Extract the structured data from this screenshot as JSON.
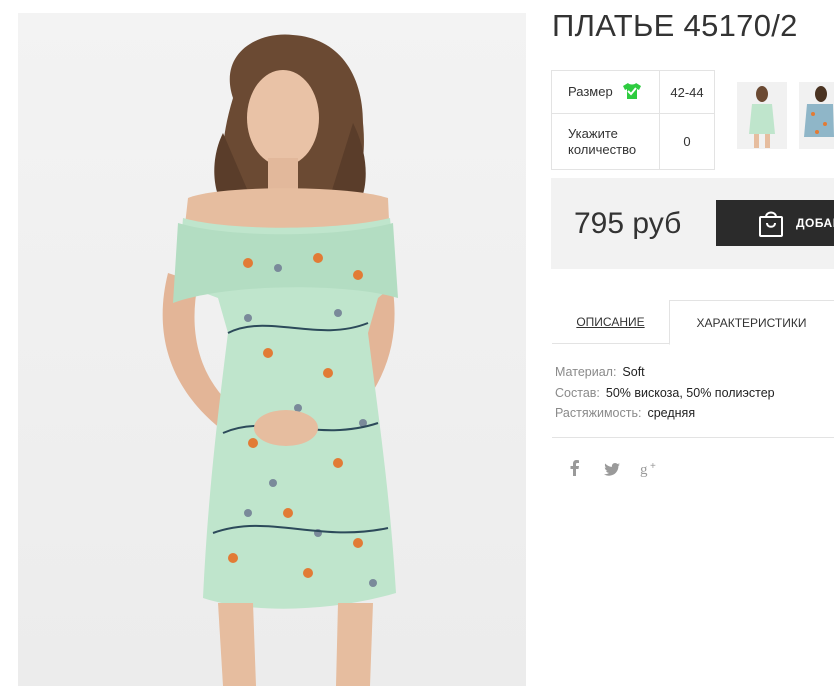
{
  "product": {
    "title": "ПЛАТЬЕ 45170/2",
    "image_icon": "product-photo"
  },
  "options": {
    "size_label": "Размер",
    "size_icon": "tshirt-check-icon",
    "size_value": "42-44",
    "qty_label": "Укажите количество",
    "qty_value": "0"
  },
  "thumbnails": [
    "thumbnail-1",
    "thumbnail-2"
  ],
  "price": {
    "value": "795 руб",
    "cart_label": "ДОБАВИТЬ",
    "cart_icon": "shopping-bag-icon"
  },
  "tabs": [
    {
      "label": "ОПИСАНИЕ"
    },
    {
      "label": "ХАРАКТЕРИСТИКИ"
    }
  ],
  "characteristics": [
    {
      "key": "Материал:",
      "value": "Soft"
    },
    {
      "key": "Состав:",
      "value": "50% вискоза, 50% полиэстер"
    },
    {
      "key": "Растяжимость:",
      "value": "средняя"
    }
  ],
  "social": [
    {
      "icon": "facebook-icon",
      "glyph": "f"
    },
    {
      "icon": "twitter-icon",
      "glyph": "🐦"
    },
    {
      "icon": "google-plus-icon",
      "glyph": "g+"
    }
  ],
  "colors": {
    "accent_dark": "#2b2b2b",
    "price_bg": "#f2f2f2",
    "check_green": "#2ecc40",
    "dress_mint": "#bfe5cc"
  }
}
